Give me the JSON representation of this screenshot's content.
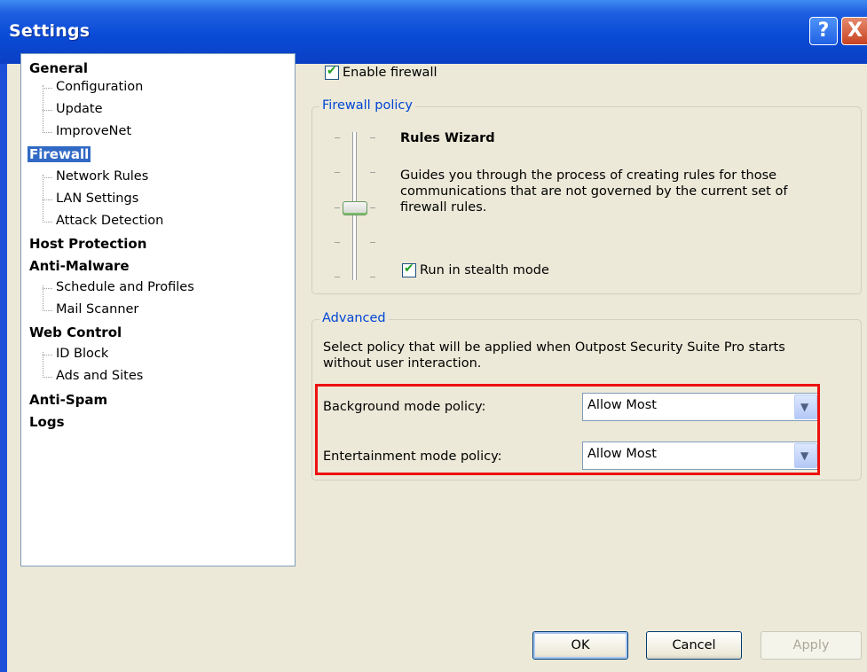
{
  "window": {
    "title": "Settings",
    "help_label": "?",
    "close_label": "X"
  },
  "tree": {
    "items": [
      {
        "label": "General",
        "level": 0
      },
      {
        "label": "Configuration",
        "level": 1
      },
      {
        "label": "Update",
        "level": 1
      },
      {
        "label": "ImproveNet",
        "level": 1
      },
      {
        "label": "Firewall",
        "level": 0,
        "selected": true
      },
      {
        "label": "Network Rules",
        "level": 1
      },
      {
        "label": "LAN Settings",
        "level": 1
      },
      {
        "label": "Attack Detection",
        "level": 1
      },
      {
        "label": "Host Protection",
        "level": 0
      },
      {
        "label": "Anti-Malware",
        "level": 0
      },
      {
        "label": "Schedule and Profiles",
        "level": 1
      },
      {
        "label": "Mail Scanner",
        "level": 1
      },
      {
        "label": "Web Control",
        "level": 0
      },
      {
        "label": "ID Block",
        "level": 1
      },
      {
        "label": "Ads and Sites",
        "level": 1
      },
      {
        "label": "Anti-Spam",
        "level": 0
      },
      {
        "label": "Logs",
        "level": 0
      }
    ]
  },
  "firewall": {
    "enable_label": "Enable firewall",
    "enable_checked": true,
    "policy_group_title": "Firewall policy",
    "policy_name": "Rules Wizard",
    "policy_description": "Guides you through the process of creating rules for those communications that are not governed by the current set of firewall rules.",
    "policy_level": 3,
    "policy_levels": 5,
    "stealth_label": "Run in stealth mode",
    "stealth_checked": true
  },
  "advanced": {
    "group_title": "Advanced",
    "description": "Select policy that will be applied when Outpost Security Suite Pro starts without user interaction.",
    "background_label": "Background mode policy:",
    "background_value": "Allow Most",
    "entertainment_label": "Entertainment mode policy:",
    "entertainment_value": "Allow Most"
  },
  "buttons": {
    "ok": "OK",
    "cancel": "Cancel",
    "apply": "Apply"
  },
  "colors": {
    "titlebar": "#0a4bd6",
    "highlight": "#ee1111",
    "selection": "#316ac5",
    "group_title": "#0046d5"
  }
}
